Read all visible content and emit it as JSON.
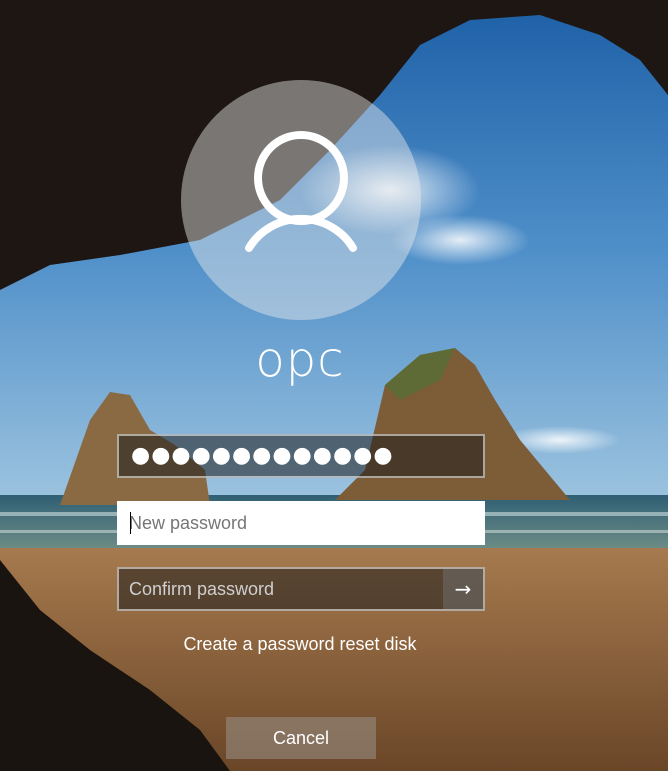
{
  "user": {
    "name": "opc",
    "avatar_icon": "user-icon"
  },
  "password_form": {
    "old_password_mask": "●●●●●●●●●●●●●",
    "new_password_placeholder": "New password",
    "confirm_password_placeholder": "Confirm password",
    "submit_icon": "arrow-right-icon",
    "submit_glyph": "→"
  },
  "links": {
    "reset_disk": "Create a password reset disk"
  },
  "actions": {
    "cancel_label": "Cancel"
  }
}
